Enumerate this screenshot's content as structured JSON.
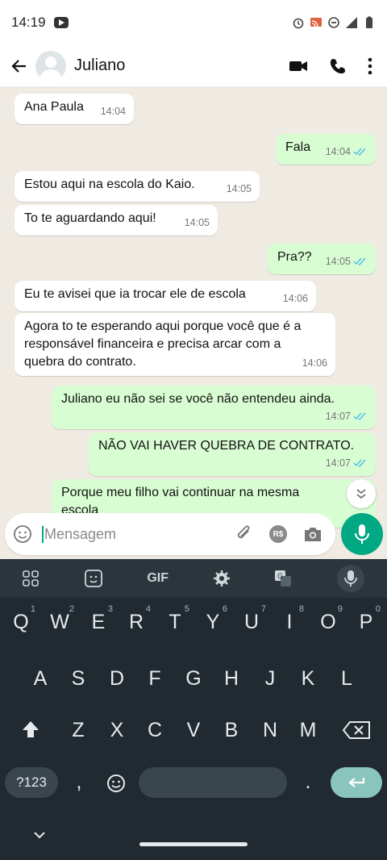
{
  "status_bar": {
    "time": "14:19"
  },
  "header": {
    "contact_name": "Juliano"
  },
  "messages": [
    {
      "dir": "in",
      "text": "Ana Paula",
      "time": "14:04"
    },
    {
      "dir": "out",
      "text": "Fala",
      "time": "14:04"
    },
    {
      "dir": "in",
      "text": "Estou aqui na escola do Kaio.",
      "time": "14:05"
    },
    {
      "dir": "in",
      "text": "To te aguardando aqui!",
      "time": "14:05"
    },
    {
      "dir": "out",
      "text": "Pra??",
      "time": "14:05"
    },
    {
      "dir": "in",
      "text": "Eu te avisei que ia trocar ele de escola",
      "time": "14:06"
    },
    {
      "dir": "in",
      "text": "Agora to te esperando aqui porque você que é a responsável financeira e precisa arcar com a quebra do contrato.",
      "time": "14:06"
    },
    {
      "dir": "out",
      "text": "Juliano eu não sei se você não entendeu ainda.",
      "time": "14:07"
    },
    {
      "dir": "out",
      "text": "NÃO VAI HAVER QUEBRA DE CONTRATO.",
      "time": "14:07"
    },
    {
      "dir": "out",
      "text": "Porque meu filho vai continuar na mesma escola",
      "time": ""
    }
  ],
  "input": {
    "placeholder": "Mensagem"
  },
  "keyboard": {
    "toolbar_gif": "GIF",
    "row1": [
      "Q",
      "W",
      "E",
      "R",
      "T",
      "Y",
      "U",
      "I",
      "O",
      "P"
    ],
    "row1_hints": [
      "1",
      "2",
      "3",
      "4",
      "5",
      "6",
      "7",
      "8",
      "9",
      "0"
    ],
    "row2": [
      "A",
      "S",
      "D",
      "F",
      "G",
      "H",
      "J",
      "K",
      "L"
    ],
    "row3": [
      "Z",
      "X",
      "C",
      "V",
      "B",
      "N",
      "M"
    ],
    "symbols_key": "?123",
    "comma": ",",
    "period": "."
  },
  "colors": {
    "accent": "#00a884",
    "outgoing_bubble": "#d9fdd3",
    "chat_bg": "#efeae2",
    "keyboard_bg": "#202a30"
  }
}
